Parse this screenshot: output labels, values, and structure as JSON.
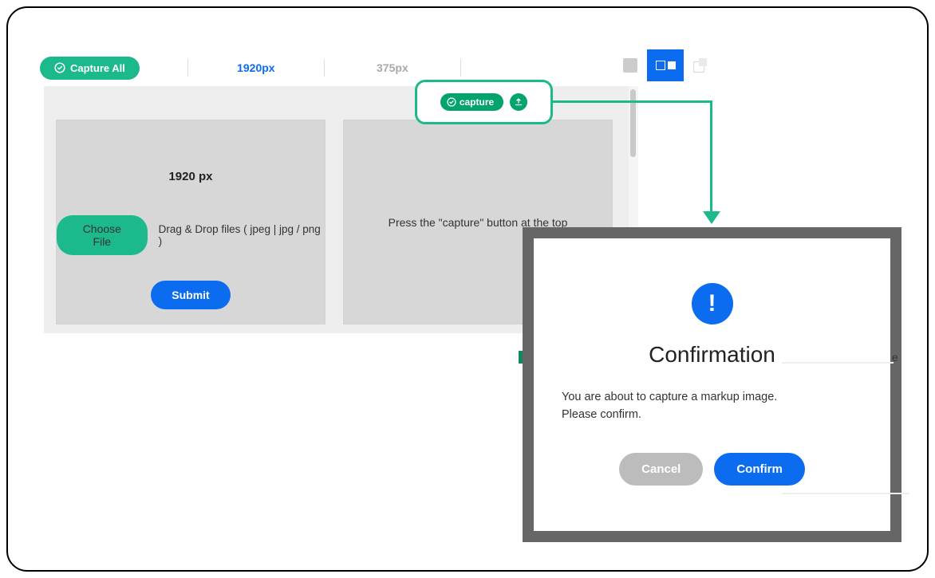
{
  "toolbar": {
    "captureAll": "Capture All",
    "tabs": [
      "1920px",
      "375px"
    ]
  },
  "leftPanel": {
    "title": "1920 px",
    "chooseFile": "Choose File",
    "dragHint": "Drag & Drop files ( jpeg | jpg / png )",
    "submit": "Submit"
  },
  "rightPanel": {
    "message": "Press the \"capture\" button at the top"
  },
  "callout": {
    "capture": "capture"
  },
  "modal": {
    "title": "Confirmation",
    "body1": "You are about to capture a markup image.",
    "body2": "Please confirm.",
    "cancel": "Cancel",
    "confirm": "Confirm"
  },
  "edge": {
    "letter": "e"
  }
}
